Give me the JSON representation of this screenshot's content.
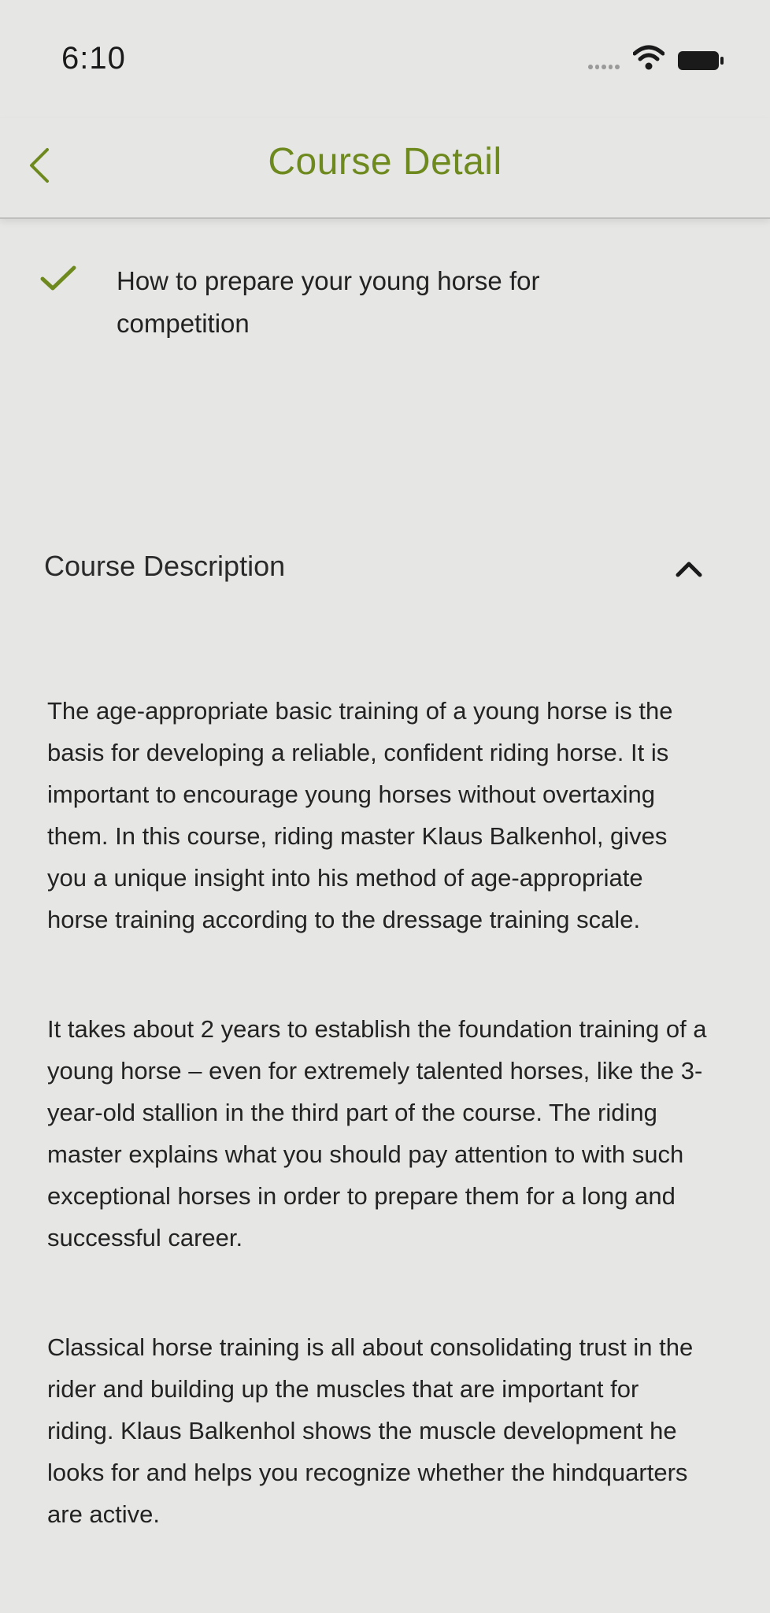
{
  "status_bar": {
    "time": "6:10"
  },
  "nav": {
    "title": "Course Detail"
  },
  "lesson": {
    "title": "How to prepare your young horse for competition"
  },
  "description": {
    "header": "Course Description",
    "paragraphs": [
      "The age-appropriate basic training of a young horse is the basis for developing a reliable, confident riding horse. It is important to encourage young horses without overtaxing them. In this course, riding master Klaus Balkenhol, gives you a unique insight into his method of age-appropriate horse training according to the dressage training scale.",
      "It takes about 2 years to establish the foundation training of a young horse – even for extremely talented horses, like the 3-year-old stallion in the third part of the course. The riding master explains what you should pay attention to with such exceptional horses in order to prepare them for a long and successful career.",
      "Classical horse training is all about consolidating trust in the rider and building up the muscles that are important for riding. Klaus Balkenhol shows the muscle development he looks for and helps you recognize whether the hindquarters are active."
    ]
  },
  "colors": {
    "accent": "#6e8a1e",
    "background": "#e6e6e4",
    "text": "#232323"
  },
  "icons": {
    "back": "chevron-left-icon",
    "check": "check-icon",
    "collapse": "chevron-up-icon",
    "wifi": "wifi-icon",
    "battery": "battery-icon"
  }
}
